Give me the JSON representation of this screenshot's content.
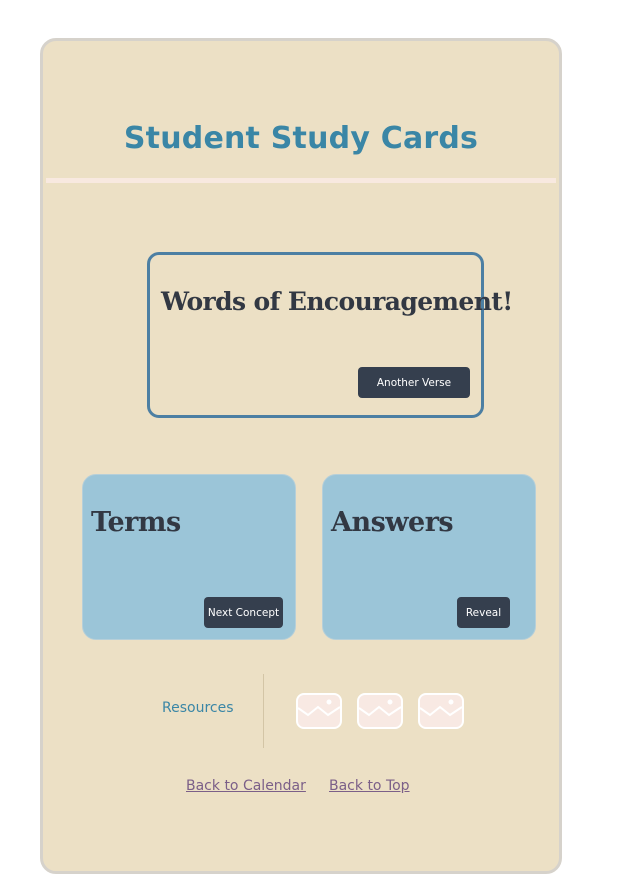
{
  "page": {
    "title": "Student Study Cards"
  },
  "verse_card": {
    "heading": "Words of Encouragement!",
    "button_label": "Another Verse"
  },
  "terms_card": {
    "heading": "Terms",
    "button_label": "Next Concept"
  },
  "answers_card": {
    "heading": "Answers",
    "button_label": "Reveal"
  },
  "resources": {
    "label": "Resources",
    "thumbnails": [
      {
        "icon": "image-placeholder-icon"
      },
      {
        "icon": "image-placeholder-icon"
      },
      {
        "icon": "image-placeholder-icon"
      }
    ]
  },
  "footer": {
    "back_to_calendar": "Back to Calendar",
    "back_to_top": "Back to Top"
  },
  "colors": {
    "page_background": "#ece0c5",
    "title": "#3a86a6",
    "card_blue": "#9bc5d8",
    "button_dark": "#353f4e",
    "link": "#7b5f88",
    "thumbnail_fill": "#f8e9e3"
  }
}
